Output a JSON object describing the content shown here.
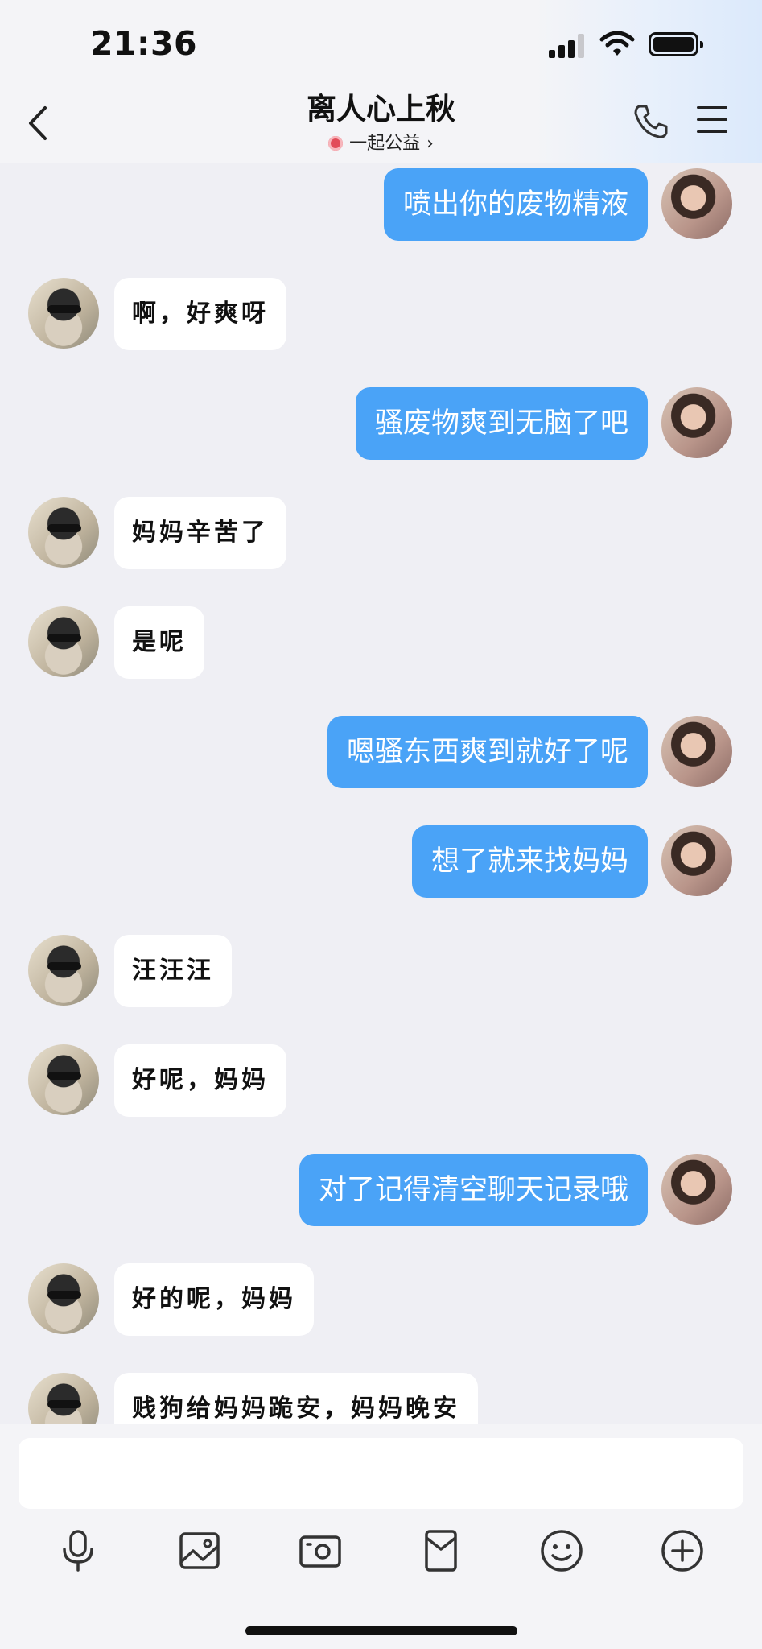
{
  "status": {
    "time": "21:36"
  },
  "header": {
    "title": "离人心上秋",
    "subtitle": "一起公益",
    "subtitle_chevron": "›"
  },
  "messages": [
    {
      "side": "out",
      "text": "喷出你的废物精液"
    },
    {
      "side": "in",
      "text": "啊，好爽呀"
    },
    {
      "side": "out",
      "text": "骚废物爽到无脑了吧"
    },
    {
      "side": "in",
      "text": "妈妈辛苦了"
    },
    {
      "side": "in",
      "text": "是呢"
    },
    {
      "side": "out",
      "text": "嗯骚东西爽到就好了呢"
    },
    {
      "side": "out",
      "text": "想了就来找妈妈"
    },
    {
      "side": "in",
      "text": "汪汪汪"
    },
    {
      "side": "in",
      "text": "好呢，妈妈"
    },
    {
      "side": "out",
      "text": "对了记得清空聊天记录哦"
    },
    {
      "side": "in",
      "text": "好的呢，妈妈"
    },
    {
      "side": "in",
      "text": "贱狗给妈妈跪安，妈妈晚安"
    }
  ],
  "input": {
    "value": ""
  },
  "toolbar": {
    "icons": [
      "microphone-icon",
      "image-icon",
      "camera-icon",
      "red-packet-icon",
      "emoji-icon",
      "plus-icon"
    ]
  }
}
